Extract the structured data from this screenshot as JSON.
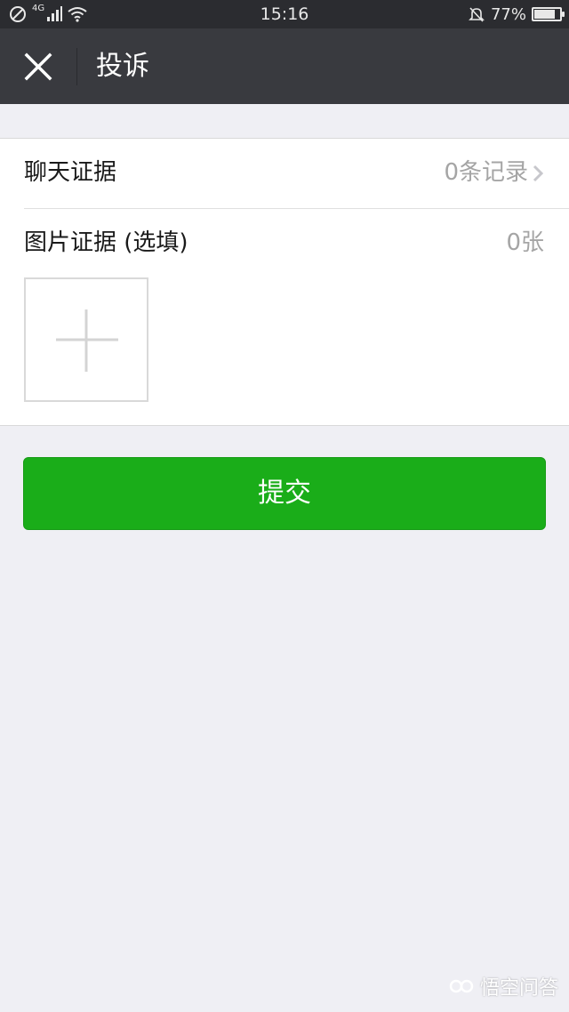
{
  "status_bar": {
    "network": "4G",
    "time": "15:16",
    "battery_percent": "77%",
    "battery_level": 0.77
  },
  "nav": {
    "title": "投诉",
    "close_icon": "close-icon"
  },
  "evidence": {
    "chat_label": "聊天证据",
    "chat_value": "0条记录",
    "photo_label": "图片证据 (选填)",
    "photo_value": "0张"
  },
  "submit_label": "提交",
  "watermark": "悟空问答",
  "colors": {
    "accent": "#1aad19",
    "navbar": "#393a3f",
    "statusbar": "#2b2c30",
    "background": "#efeff4"
  }
}
